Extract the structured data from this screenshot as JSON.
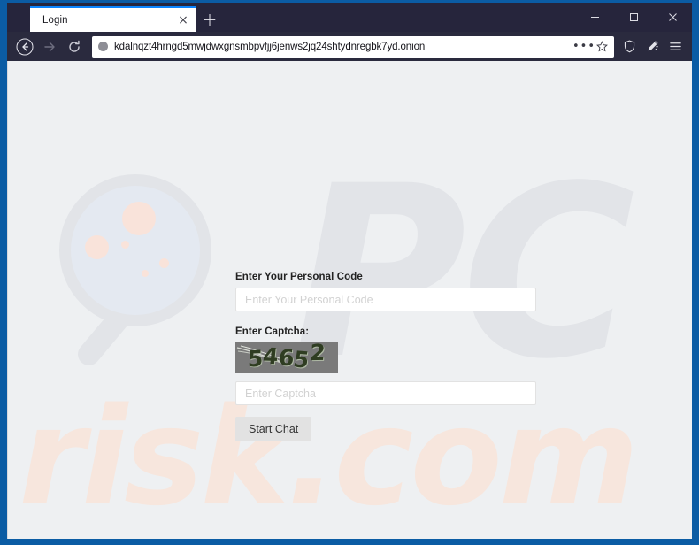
{
  "window": {
    "controls": {
      "minimize": "minimize-button",
      "maximize": "maximize-button",
      "close": "close-button"
    }
  },
  "tabs": [
    {
      "title": "Login",
      "close_label": "×",
      "active": true
    }
  ],
  "new_tab_label": "+",
  "toolbar": {
    "back_label": "Back",
    "forward_label": "Forward",
    "reload_label": "Reload",
    "url": "kdalnqzt4hrngd5mwjdwxgnsmbpvfjj6jenws2jq24shtydnregbk7yd.onion",
    "identity_icon": "globe-icon",
    "page_actions_label": "•••",
    "bookmark_icon": "star-icon",
    "shield_icon": "shield-icon",
    "new_identity_icon": "broom-icon",
    "menu_icon": "hamburger-menu-icon"
  },
  "page": {
    "watermark": {
      "logo": "magnifying-glass-logo",
      "brand_primary": "PC",
      "brand_secondary": "risk.com"
    },
    "form": {
      "personal_code": {
        "label": "Enter Your Personal Code",
        "placeholder": "Enter Your Personal Code",
        "value": ""
      },
      "captcha": {
        "label": "Enter Captcha:",
        "image_text": "54652",
        "digits": [
          "5",
          "4",
          "6",
          "5",
          "2"
        ],
        "placeholder": "Enter Captcha",
        "value": ""
      },
      "submit_label": "Start Chat"
    }
  },
  "colors": {
    "frame_blue": "#0b5ca4",
    "chrome_dark": "#2a2a3e",
    "tab_accent": "#0a84ff",
    "page_bg": "#eef0f2",
    "watermark_gray": "#e2e4e8",
    "watermark_peach": "#f7e6dd",
    "captcha_bg": "#7a7a7a",
    "captcha_fg": "#2f3d22",
    "button_bg": "#e2e2e2"
  }
}
